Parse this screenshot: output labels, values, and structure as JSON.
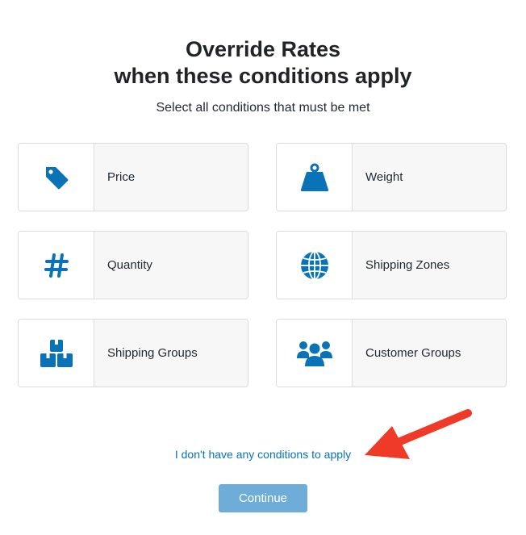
{
  "header": {
    "title": "Override Rates",
    "subtitle": "when these conditions apply",
    "instruction": "Select all conditions that must be met"
  },
  "conditions": [
    {
      "label": "Price",
      "icon": "tag-icon"
    },
    {
      "label": "Weight",
      "icon": "weight-icon"
    },
    {
      "label": "Quantity",
      "icon": "hash-icon"
    },
    {
      "label": "Shipping Zones",
      "icon": "globe-icon"
    },
    {
      "label": "Shipping Groups",
      "icon": "boxes-icon"
    },
    {
      "label": "Customer Groups",
      "icon": "users-icon"
    }
  ],
  "footer": {
    "no_conditions_link": "I don't have any conditions to apply",
    "continue_label": "Continue"
  },
  "colors": {
    "icon_blue": "#0a73b8",
    "link_blue": "#0a73b8",
    "button_bg": "#6dadd8",
    "annotation_arrow": "#ee3a27"
  }
}
